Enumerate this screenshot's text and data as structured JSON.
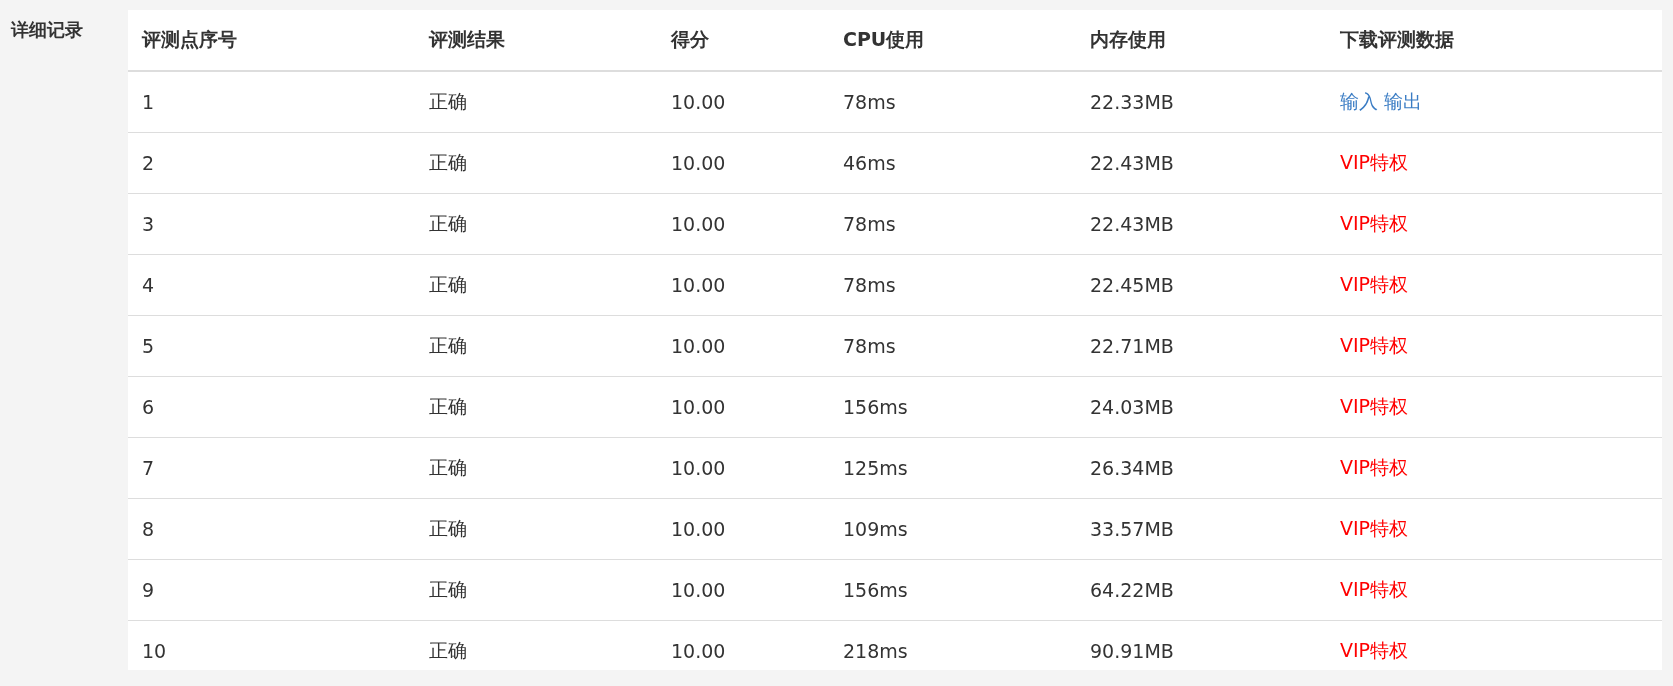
{
  "section_label": "详细记录",
  "table": {
    "columns": [
      "评测点序号",
      "评测结果",
      "得分",
      "CPU使用",
      "内存使用",
      "下载评测数据"
    ],
    "rows": [
      {
        "index": "1",
        "result": "正确",
        "score": "10.00",
        "cpu": "78ms",
        "memory": "22.33MB",
        "download": {
          "kind": "links",
          "links": [
            "输入",
            "输出"
          ]
        }
      },
      {
        "index": "2",
        "result": "正确",
        "score": "10.00",
        "cpu": "46ms",
        "memory": "22.43MB",
        "download": {
          "kind": "vip",
          "text": "VIP特权"
        }
      },
      {
        "index": "3",
        "result": "正确",
        "score": "10.00",
        "cpu": "78ms",
        "memory": "22.43MB",
        "download": {
          "kind": "vip",
          "text": "VIP特权"
        }
      },
      {
        "index": "4",
        "result": "正确",
        "score": "10.00",
        "cpu": "78ms",
        "memory": "22.45MB",
        "download": {
          "kind": "vip",
          "text": "VIP特权"
        }
      },
      {
        "index": "5",
        "result": "正确",
        "score": "10.00",
        "cpu": "78ms",
        "memory": "22.71MB",
        "download": {
          "kind": "vip",
          "text": "VIP特权"
        }
      },
      {
        "index": "6",
        "result": "正确",
        "score": "10.00",
        "cpu": "156ms",
        "memory": "24.03MB",
        "download": {
          "kind": "vip",
          "text": "VIP特权"
        }
      },
      {
        "index": "7",
        "result": "正确",
        "score": "10.00",
        "cpu": "125ms",
        "memory": "26.34MB",
        "download": {
          "kind": "vip",
          "text": "VIP特权"
        }
      },
      {
        "index": "8",
        "result": "正确",
        "score": "10.00",
        "cpu": "109ms",
        "memory": "33.57MB",
        "download": {
          "kind": "vip",
          "text": "VIP特权"
        }
      },
      {
        "index": "9",
        "result": "正确",
        "score": "10.00",
        "cpu": "156ms",
        "memory": "64.22MB",
        "download": {
          "kind": "vip",
          "text": "VIP特权"
        }
      },
      {
        "index": "10",
        "result": "正确",
        "score": "10.00",
        "cpu": "218ms",
        "memory": "90.91MB",
        "download": {
          "kind": "vip",
          "text": "VIP特权"
        }
      }
    ]
  }
}
